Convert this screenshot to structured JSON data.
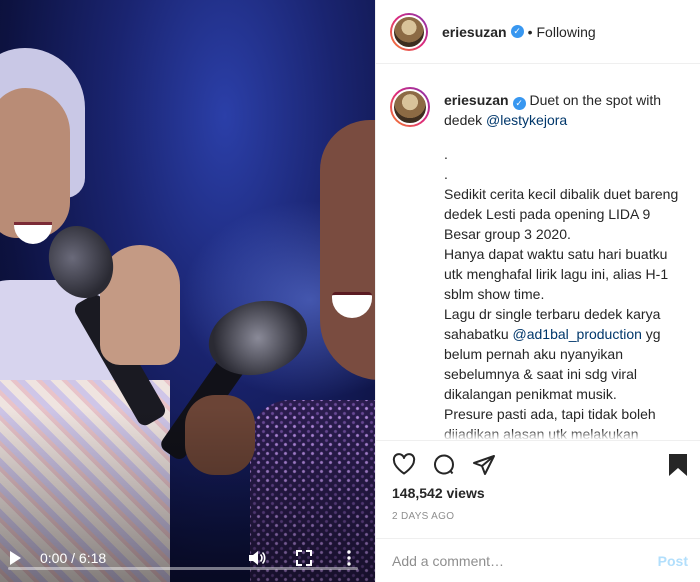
{
  "video": {
    "time_display": "0:00 / 6:18",
    "progress": 0
  },
  "post": {
    "username": "eriesuzan",
    "follow_state": "Following",
    "separator": "•",
    "caption_title": "Duet on the spot with dedek",
    "mention": "@lestykejora",
    "caption_body_1": ".\n.\nSedikit cerita kecil dibalik duet bareng dedek Lesti pada opening LIDA 9 Besar group 3 2020.\nHanya dapat waktu satu hari buatku utk menghafal lirik lagu ini, alias H-1 sblm show time.\nLagu dr single terbaru dedek karya sahabatku ",
    "mention_2": "@ad1bal_production",
    "caption_body_2": " yg belum pernah aku nyanyikan sebelumnya & saat ini sdg viral dikalangan penikmat musik.\nPresure pasti ada, tapi tidak boleh dijadikan alasan utk melakukan kesalahan karena dapat berakibat fatal pada sebuah pertunjukan",
    "views": "148,542 views",
    "time_ago": "2 DAYS AGO"
  },
  "comment": {
    "placeholder": "Add a comment…",
    "post_label": "Post"
  },
  "colors": {
    "link": "#00376b",
    "verified": "#3897f0",
    "post_button_disabled": "#b2dffc"
  }
}
